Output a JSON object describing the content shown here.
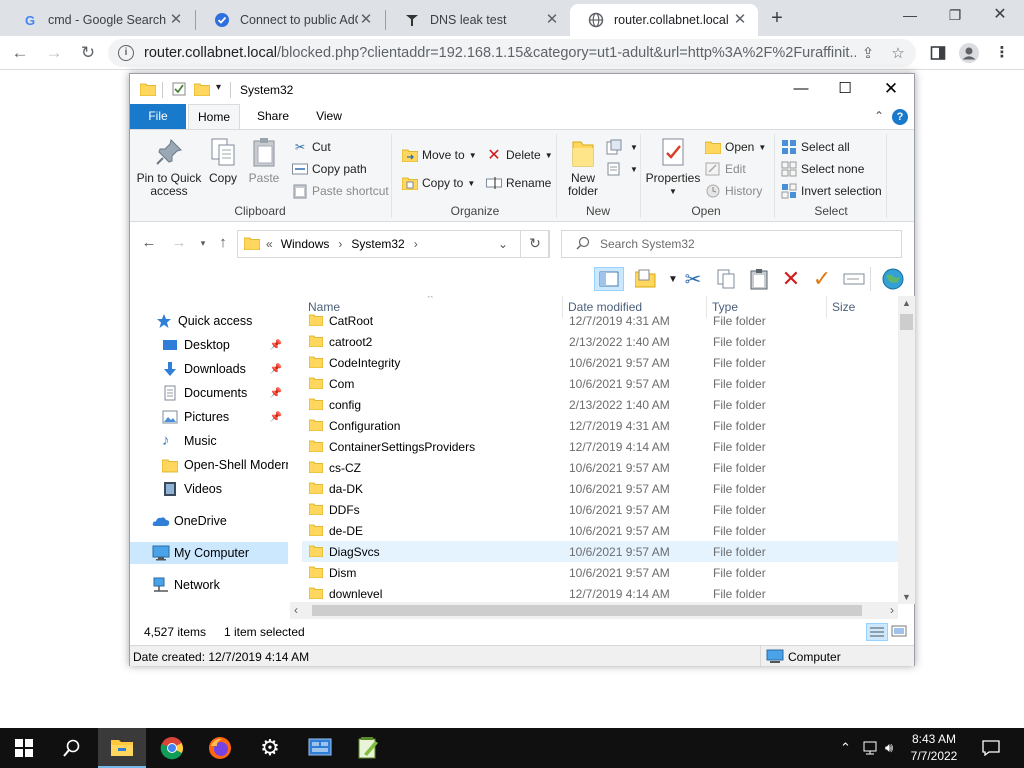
{
  "browser": {
    "tabs": [
      {
        "title": "cmd - Google Search",
        "favicon": "google-g-icon",
        "active": false
      },
      {
        "title": "Connect to public AdG",
        "favicon": "adguard-check-icon",
        "active": false
      },
      {
        "title": "DNS leak test",
        "favicon": "dnsleaktest-icon",
        "active": false
      },
      {
        "title": "router.collabnet.local",
        "favicon": "globe-icon",
        "active": true
      }
    ],
    "new_tab_label": "+",
    "url_host": "router.collabnet.local",
    "url_rest": "/blocked.php?clientaddr=192.168.1.15&category=ut1-adult&url=http%3A%2F%2Furaffinit..."
  },
  "explorer": {
    "title": "System32",
    "ribbon_tabs": [
      "File",
      "Home",
      "Share",
      "View"
    ],
    "clipboard": {
      "pin": "Pin to Quick access",
      "copy": "Copy",
      "paste": "Paste",
      "cut": "Cut",
      "copy_path": "Copy path",
      "paste_shortcut": "Paste shortcut",
      "label": "Clipboard"
    },
    "organize": {
      "move_to": "Move to",
      "copy_to": "Copy to",
      "delete": "Delete",
      "rename": "Rename",
      "label": "Organize"
    },
    "new": {
      "new_folder": "New folder",
      "label": "New"
    },
    "open": {
      "properties": "Properties",
      "open": "Open",
      "edit": "Edit",
      "history": "History",
      "label": "Open"
    },
    "select": {
      "select_all": "Select all",
      "select_none": "Select none",
      "invert": "Invert selection",
      "label": "Select"
    },
    "breadcrumb": [
      "Windows",
      "System32"
    ],
    "search_placeholder": "Search System32",
    "nav": [
      {
        "label": "Quick access",
        "icon": "star-icon",
        "indent": 1,
        "pinned": false
      },
      {
        "label": "Desktop",
        "icon": "desktop-icon",
        "indent": 2,
        "pinned": true
      },
      {
        "label": "Downloads",
        "icon": "download-icon",
        "indent": 2,
        "pinned": true
      },
      {
        "label": "Documents",
        "icon": "documents-icon",
        "indent": 2,
        "pinned": true
      },
      {
        "label": "Pictures",
        "icon": "pictures-icon",
        "indent": 2,
        "pinned": true
      },
      {
        "label": "Music",
        "icon": "music-icon",
        "indent": 2,
        "pinned": false
      },
      {
        "label": "Open-Shell Modern",
        "icon": "folder-icon",
        "indent": 2,
        "pinned": false
      },
      {
        "label": "Videos",
        "icon": "videos-icon",
        "indent": 2,
        "pinned": false
      },
      {
        "label": "OneDrive",
        "icon": "onedrive-icon",
        "indent": 1,
        "pinned": false
      },
      {
        "label": "My Computer",
        "icon": "computer-icon",
        "indent": 1,
        "pinned": false,
        "selected": true
      },
      {
        "label": "Network",
        "icon": "network-icon",
        "indent": 1,
        "pinned": false
      }
    ],
    "columns": [
      "Name",
      "Date modified",
      "Type",
      "Size"
    ],
    "files": [
      {
        "name": "CatRoot",
        "date": "12/7/2019 4:31 AM",
        "type": "File folder"
      },
      {
        "name": "catroot2",
        "date": "2/13/2022 1:40 AM",
        "type": "File folder"
      },
      {
        "name": "CodeIntegrity",
        "date": "10/6/2021 9:57 AM",
        "type": "File folder"
      },
      {
        "name": "Com",
        "date": "10/6/2021 9:57 AM",
        "type": "File folder"
      },
      {
        "name": "config",
        "date": "2/13/2022 1:40 AM",
        "type": "File folder"
      },
      {
        "name": "Configuration",
        "date": "12/7/2019 4:31 AM",
        "type": "File folder"
      },
      {
        "name": "ContainerSettingsProviders",
        "date": "12/7/2019 4:14 AM",
        "type": "File folder"
      },
      {
        "name": "cs-CZ",
        "date": "10/6/2021 9:57 AM",
        "type": "File folder"
      },
      {
        "name": "da-DK",
        "date": "10/6/2021 9:57 AM",
        "type": "File folder"
      },
      {
        "name": "DDFs",
        "date": "10/6/2021 9:57 AM",
        "type": "File folder"
      },
      {
        "name": "de-DE",
        "date": "10/6/2021 9:57 AM",
        "type": "File folder"
      },
      {
        "name": "DiagSvcs",
        "date": "10/6/2021 9:57 AM",
        "type": "File folder",
        "selected": true
      },
      {
        "name": "Dism",
        "date": "10/6/2021 9:57 AM",
        "type": "File folder"
      },
      {
        "name": "downlevel",
        "date": "12/7/2019 4:14 AM",
        "type": "File folder"
      }
    ],
    "status": {
      "item_count": "4,527 items",
      "selected": "1 item selected",
      "date_created": "Date created: 12/7/2019 4:14 AM",
      "location": "Computer"
    }
  },
  "taskbar": {
    "apps": [
      "file-explorer-icon",
      "chrome-icon",
      "firefox-icon",
      "settings-gear-icon",
      "control-panel-icon",
      "notepad-plus-icon"
    ],
    "time": "8:43 AM",
    "date": "7/7/2022"
  },
  "colors": {
    "file_tab": "#1979ca",
    "folder": "#ffd75e",
    "selected_row": "#e5f3ff",
    "selected_nav": "#cce8ff",
    "taskbar": "#101010"
  }
}
